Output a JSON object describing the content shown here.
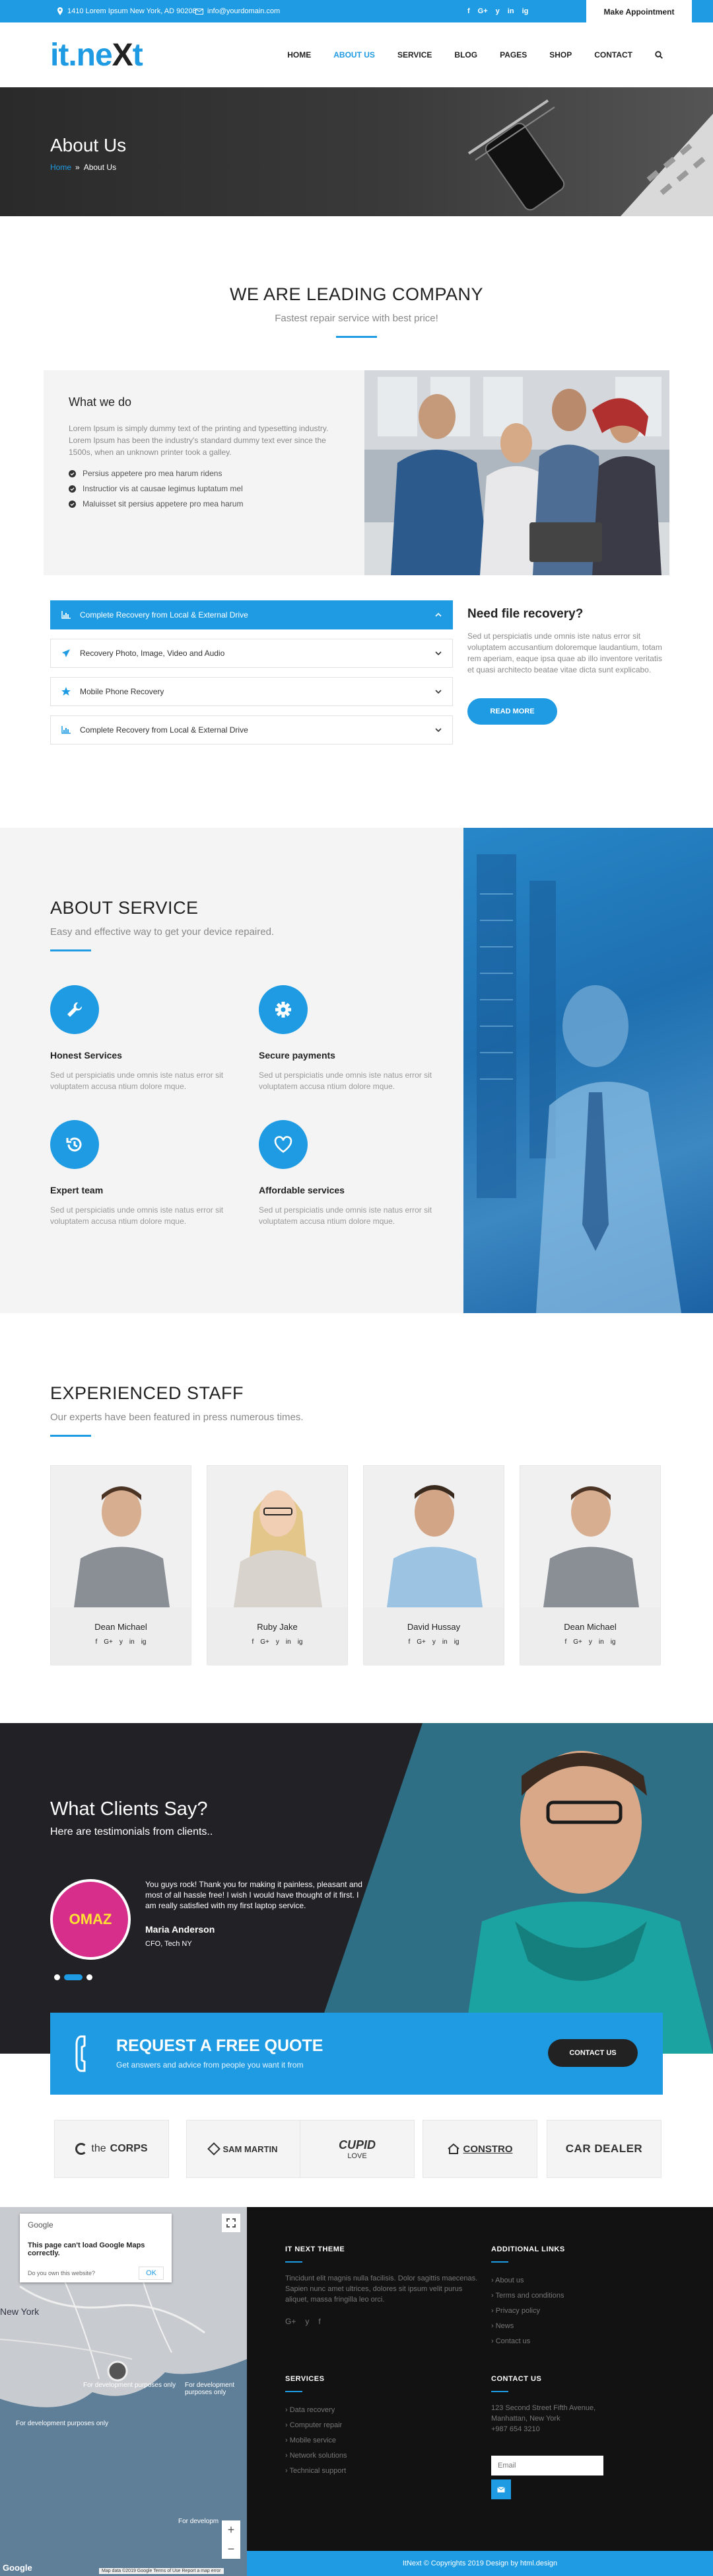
{
  "topbar": {
    "address": "1410 Lorem Ipsum New York, AD 90208",
    "email": "info@yourdomain.com",
    "social": [
      "f",
      "G+",
      "y",
      "in",
      "ig"
    ],
    "appointment": "Make Appointment"
  },
  "header": {
    "logo_a": "it.ne",
    "logo_b": "X",
    "logo_c": "t",
    "nav": [
      "HOME",
      "ABOUT US",
      "SERVICE",
      "BLOG",
      "PAGES",
      "SHOP",
      "CONTACT"
    ]
  },
  "hero": {
    "title": "About Us",
    "crumb_home": "Home",
    "crumb_sep": "»",
    "crumb_current": "About Us"
  },
  "leading": {
    "title": "WE ARE LEADING COMPANY",
    "subtitle": "Fastest repair service with best price!"
  },
  "what_we_do": {
    "title": "What we do",
    "text": "Lorem Ipsum is simply dummy text of the printing and typesetting industry. Lorem Ipsum has been the industry's standard dummy text ever since the 1500s, when an unknown printer took a galley.",
    "bullets": [
      "Persius appetere pro mea harum ridens",
      "Instructior vis at causae legimus luptatum mel",
      "Maluisset sit persius appetere pro mea harum"
    ]
  },
  "accordion": [
    "Complete Recovery from Local & External Drive",
    "Recovery Photo, Image, Video and Audio",
    "Mobile Phone Recovery",
    "Complete Recovery from Local & External Drive"
  ],
  "recovery": {
    "title": "Need file recovery?",
    "text": "Sed ut perspiciatis unde omnis iste natus error sit voluptatem accusantium doloremque laudantium, totam rem aperiam, eaque ipsa quae ab illo inventore veritatis et quasi architecto beatae vitae dicta sunt explicabo.",
    "button": "READ MORE"
  },
  "about_service": {
    "title": "ABOUT SERVICE",
    "subtitle": "Easy and effective way to get your device repaired.",
    "items": [
      {
        "title": "Honest Services",
        "text": "Sed ut perspiciatis unde omnis iste natus error sit voluptatem accusa ntium dolore mque."
      },
      {
        "title": "Secure payments",
        "text": "Sed ut perspiciatis unde omnis iste natus error sit voluptatem accusa ntium dolore mque."
      },
      {
        "title": "Expert team",
        "text": "Sed ut perspiciatis unde omnis iste natus error sit voluptatem accusa ntium dolore mque."
      },
      {
        "title": "Affordable services",
        "text": "Sed ut perspiciatis unde omnis iste natus error sit voluptatem accusa ntium dolore mque."
      }
    ]
  },
  "staff": {
    "title": "EXPERIENCED STAFF",
    "subtitle": "Our experts have been featured in press numerous times.",
    "members": [
      "Dean Michael",
      "Ruby Jake",
      "David Hussay",
      "Dean Michael"
    ],
    "social": [
      "f",
      "G+",
      "y",
      "in",
      "ig"
    ]
  },
  "testimonials": {
    "title": "What Clients Say?",
    "subtitle": "Here are testimonials from clients..",
    "quote": "You guys rock! Thank you for making it painless, pleasant and most of all hassle free! I wish I would have thought of it first. I am really satisfied with my first laptop service.",
    "name": "Maria Anderson",
    "role": "CFO, Tech NY",
    "avatar_text": "OMAZ"
  },
  "quote_banner": {
    "title": "REQUEST A FREE QUOTE",
    "subtitle": "Get answers and advice from people you want it from",
    "button": "CONTACT US"
  },
  "brands": [
    {
      "a": "the",
      "b": "CORPS"
    },
    {
      "a": "SAM MARTIN",
      "b": ""
    },
    {
      "a": "CUPID",
      "b": "LOVE"
    },
    {
      "a": "CONSTRO",
      "b": ""
    },
    {
      "a": "CAR DEALER",
      "b": ""
    }
  ],
  "map": {
    "google": "Google",
    "error": "This page can't load Google Maps correctly.",
    "own": "Do you own this website?",
    "ok": "OK",
    "label_ny": "New York",
    "dev1": "For development purposes only",
    "dev2": "For development purposes only",
    "dev3": "For development purposes only",
    "dev4": "For developm",
    "logo": "Google",
    "terms": "Map data ©2019 Google  Terms of Use  Report a map error"
  },
  "footer": {
    "theme_title": "IT NEXT THEME",
    "theme_text": "Tincidunt elit magnis nulla facilisis. Dolor sagittis maecenas. Sapien nunc amet ultrices, dolores sit ipsum velit purus aliquet, massa fringilla leo orci.",
    "theme_social": [
      "G+",
      "y",
      "f"
    ],
    "links_title": "ADDITIONAL LINKS",
    "links": [
      "› About us",
      "› Terms and conditions",
      "› Privacy policy",
      "› News",
      "› Contact us"
    ],
    "services_title": "SERVICES",
    "services": [
      "› Data recovery",
      "› Computer repair",
      "› Mobile service",
      "› Network solutions",
      "› Technical support"
    ],
    "contact_title": "CONTACT US",
    "contact": [
      "123 Second Street Fifth Avenue,",
      "Manhattan, New York",
      "+987 654 3210"
    ],
    "email_placeholder": "Email",
    "copyright": "ItNext © Copyrights 2019 Design by html.design"
  },
  "colors": {
    "accent": "#1e9be2",
    "dark": "#121212"
  }
}
